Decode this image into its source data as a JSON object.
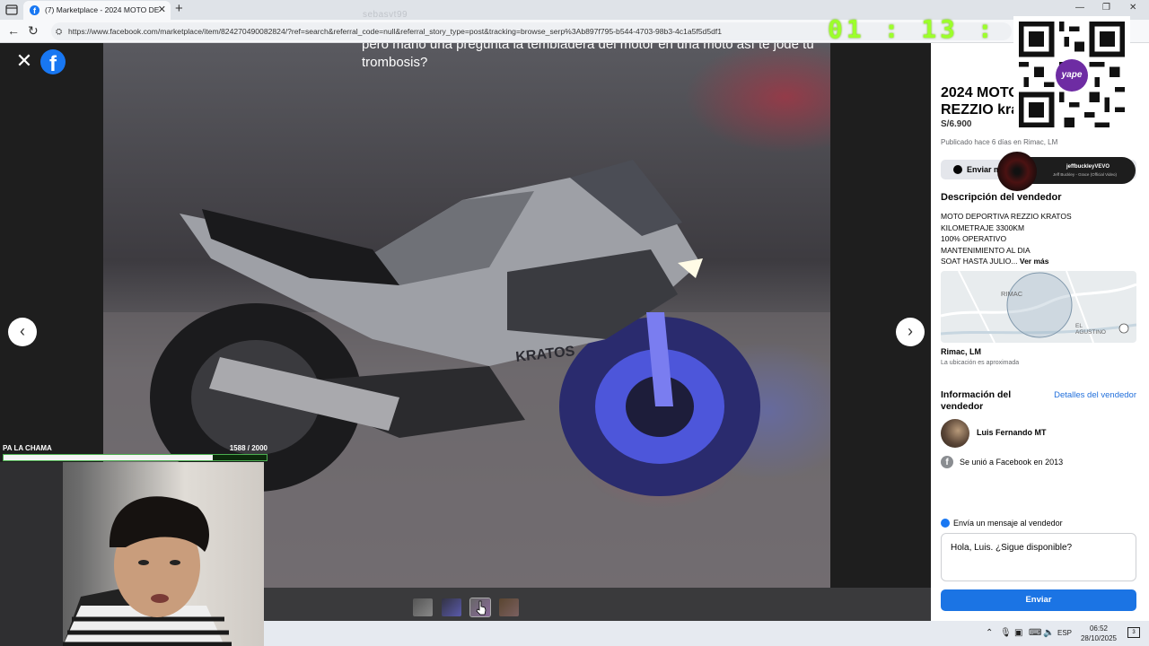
{
  "browser": {
    "tab_title": "(7) Marketplace - 2024 MOTO DE",
    "url": "https://www.facebook.com/marketplace/item/824270490082824/?ref=search&referral_code=null&referral_story_type=post&tracking=browse_serp%3Ab897f795-b544-4703-98b3-4c1a5f5d5df1",
    "user_handle": "sebasvt99"
  },
  "stream_overlay": {
    "timer": "01 : 13 : 20",
    "goal_label": "PA LA CHAMA",
    "goal_count": "1588  / 2000",
    "goal_progress": 0.794,
    "music_artist": "jeffbuckleyVEVO",
    "music_song": "Jeff Buckley - Grace (Official Video)",
    "qr_brand": "yape"
  },
  "viewer": {
    "caption": "pero mano una pregunta la tembladera del motor en una moto así te jode tu trombosis?",
    "bike_brand_text": "KRATOS",
    "thumb_count": 4
  },
  "listing": {
    "title": "2024 MOTO DE REZZIO kratos",
    "title_visible": "2024 MOTO\nREZZIO kra",
    "price": "S/6.900",
    "posted": "Publicado hace 6 días en Rimac, LM",
    "message_button": "Enviar mensaje",
    "message_button_visible": "Enviar m",
    "description_heading": "Descripción del vendedor",
    "description_lines": [
      "MOTO DEPORTIVA REZZIO KRATOS",
      "KILOMETRAJE 3300KM",
      "100% OPERATIVO",
      "MANTENIMIENTO AL DIA",
      "SOAT HASTA JULIO..."
    ],
    "see_more": "Ver más",
    "map_label_1": "RIMAC",
    "map_label_2": "EL\nAGUSTINO",
    "location": "Rimac, LM",
    "location_note": "La ubicación es aproximada",
    "seller_heading": "Información del vendedor",
    "seller_details_link": "Detalles del vendedor",
    "seller_name": "Luis Fernando MT",
    "joined": "Se unió a Facebook en 2013",
    "send_heading": "Envía un mensaje al vendedor",
    "message_value": "Hola, Luis. ¿Sigue disponible?",
    "send_button": "Enviar"
  },
  "taskbar": {
    "lang": "ESP",
    "time": "06:52",
    "date": "28/10/2025",
    "notif_count": "3"
  },
  "colors": {
    "facebook_blue": "#1877f2",
    "timer_green": "#9cff2a",
    "yape_purple": "#6e2ca3"
  }
}
